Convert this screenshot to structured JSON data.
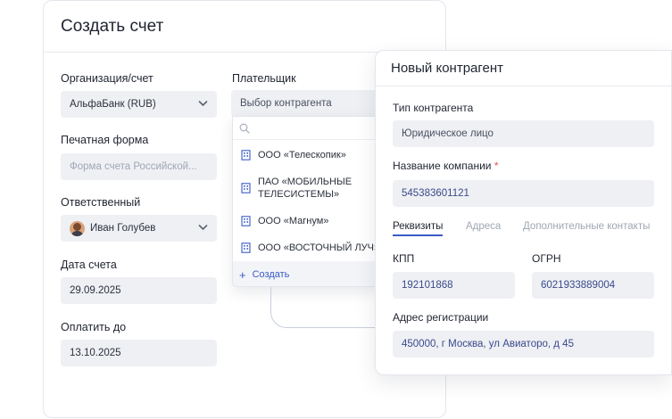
{
  "invoice_form": {
    "title": "Создать счет",
    "organization": {
      "label": "Организация/счет",
      "value": "АльфаБанк (RUB)"
    },
    "payer": {
      "label": "Плательщик",
      "placeholder": "Выбор контрагента"
    },
    "print_form": {
      "label": "Печатная форма",
      "placeholder": "Форма счета Российской..."
    },
    "responsible": {
      "label": "Ответственный",
      "value": "Иван Голубев"
    },
    "invoice_date": {
      "label": "Дата счета",
      "value": "29.09.2025"
    },
    "pay_until": {
      "label": "Оплатить до",
      "value": "13.10.2025"
    }
  },
  "payer_dropdown": {
    "items": [
      {
        "lines": [
          "ООО «Телескопик»"
        ]
      },
      {
        "lines": [
          "ПАО «МОБИЛЬНЫЕ",
          "ТЕЛЕСИСТЕМЫ»"
        ]
      },
      {
        "lines": [
          "ООО «Магнум»"
        ]
      },
      {
        "lines": [
          "ООО «ВОСТОЧНЫЙ ЛУЧ»"
        ]
      }
    ],
    "create_label": "Создать"
  },
  "new_counterparty": {
    "title": "Новый контрагент",
    "type": {
      "label": "Тип контрагента",
      "value": "Юридическое лицо"
    },
    "company_name": {
      "label": "Название компании",
      "required_mark": "*",
      "value": "545383601121"
    },
    "tabs": [
      "Реквизиты",
      "Адреса",
      "Дополнительные контакты"
    ],
    "active_tab": "Реквизиты",
    "kpp": {
      "label": "КПП",
      "value": "192101868"
    },
    "ogrn": {
      "label": "ОГРН",
      "value": "6021933889004"
    },
    "address": {
      "label": "Адрес регистрации",
      "value": "450000, г Москва, ул Авиаторо, д 45"
    }
  },
  "colors": {
    "accent": "#3a5bc7",
    "field_bg": "#eef0f4",
    "required": "#e0525a"
  },
  "icons": [
    "chevron-down-icon",
    "search-icon",
    "building-icon",
    "plus-icon",
    "avatar"
  ]
}
